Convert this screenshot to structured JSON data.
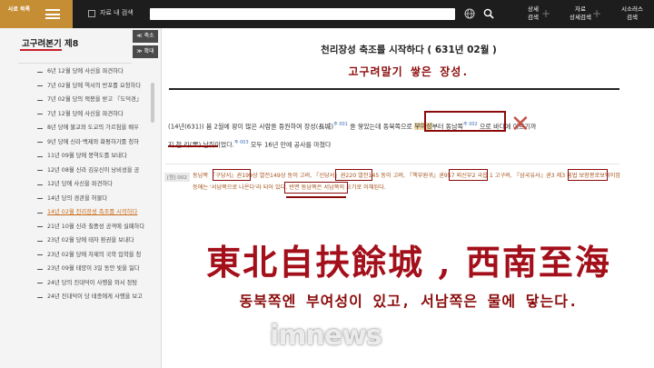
{
  "topbar": {
    "brand_label": "사료 목록",
    "search_scope": "자료 내 검색",
    "search_value": "",
    "buttons": [
      {
        "label": "상세\n검색"
      },
      {
        "label": "자료\n상세검색"
      },
      {
        "label": "시소러스\n검색"
      }
    ]
  },
  "sidebar": {
    "title": "고구려본기 제8",
    "collapse_label": "≪ 축소",
    "expand_label": "≫ 확대",
    "items": [
      {
        "label": "6년 12월 당에 사신을 파견하다"
      },
      {
        "label": "7년 02월 당에 역서의 반포를 요청하다"
      },
      {
        "label": "7년 02월 당의 책봉을 받고 『도덕경』"
      },
      {
        "label": "7년 12월 당에 사신을 파견하다"
      },
      {
        "label": "8년 당에 불교와 도교의 가르침을 배우"
      },
      {
        "label": "9년 당에 신라·백제와 화평하기를 청하"
      },
      {
        "label": "11년 09월 당에 봉역도를 보내다"
      },
      {
        "label": "12년 08월 신라 김유신이 낭비성을 공"
      },
      {
        "label": "12년 당에 사신을 파견하다"
      },
      {
        "label": "14년 당의 경관을 허물다"
      },
      {
        "label": "14년 02월 천리장성 축조를 시작하다"
      },
      {
        "label": "21년 10월 신라 칠중성 공격에 실패하다"
      },
      {
        "label": "23년 02월 당에 태자 환권을 보내다"
      },
      {
        "label": "23년 02월 당에 자제의 국학 입학을 청"
      },
      {
        "label": "23년 09월 태양이 3일 동안 빛을 잃다"
      },
      {
        "label": "24년 당의 진대덕이 사행을 와서 정탐"
      },
      {
        "label": "24년 진대덕이 당 태종에게 사행을 보고"
      }
    ],
    "active_index": 10
  },
  "document": {
    "title": "천리장성 축조를 시작하다 ( 631년 02월 )",
    "caption_top": "고구려말기 쌓은 장성.",
    "para_a": "(14년(631))   봄 2월에 왕이 많은 사람을 동원하여 장성(長城)",
    "para_fn1": "주 001",
    "para_b": " 을 쌓았는데 ",
    "para_c": "동북쪽으로 ",
    "para_d": "부여성",
    "para_e": "부터 동남쪽",
    "para_fn2": "주 002",
    "para_f": " 으로 바다에 이르기까",
    "para_g": "지 천 리(里) 남짓이었다.",
    "para_fn3": "주 003",
    "para_h": " 모두 16년 만에 공사를 마쳤다",
    "footnote_tag": "[원] 002",
    "footnote_text": "동남쪽 『구당서』권199상 열전149상 동이 고려, 『신당서』권220 열전145 동이 고려, 『책부원귀』권957 외신부2 국읍 1 고구려, 『삼국유사』권3 제3 흥법 보장봉로보덕이암 등에는 '서남쪽으로 나온다'라 되어 있다. 반면 동남쪽은 서남쪽의 오기로 이해된다.",
    "overlay_hanja": "東北自扶餘城 , 西南至海",
    "caption_bottom": "동북쪽엔 부여성이 있고, 서남쪽은 물에 닿는다.",
    "watermark": "imnews"
  }
}
